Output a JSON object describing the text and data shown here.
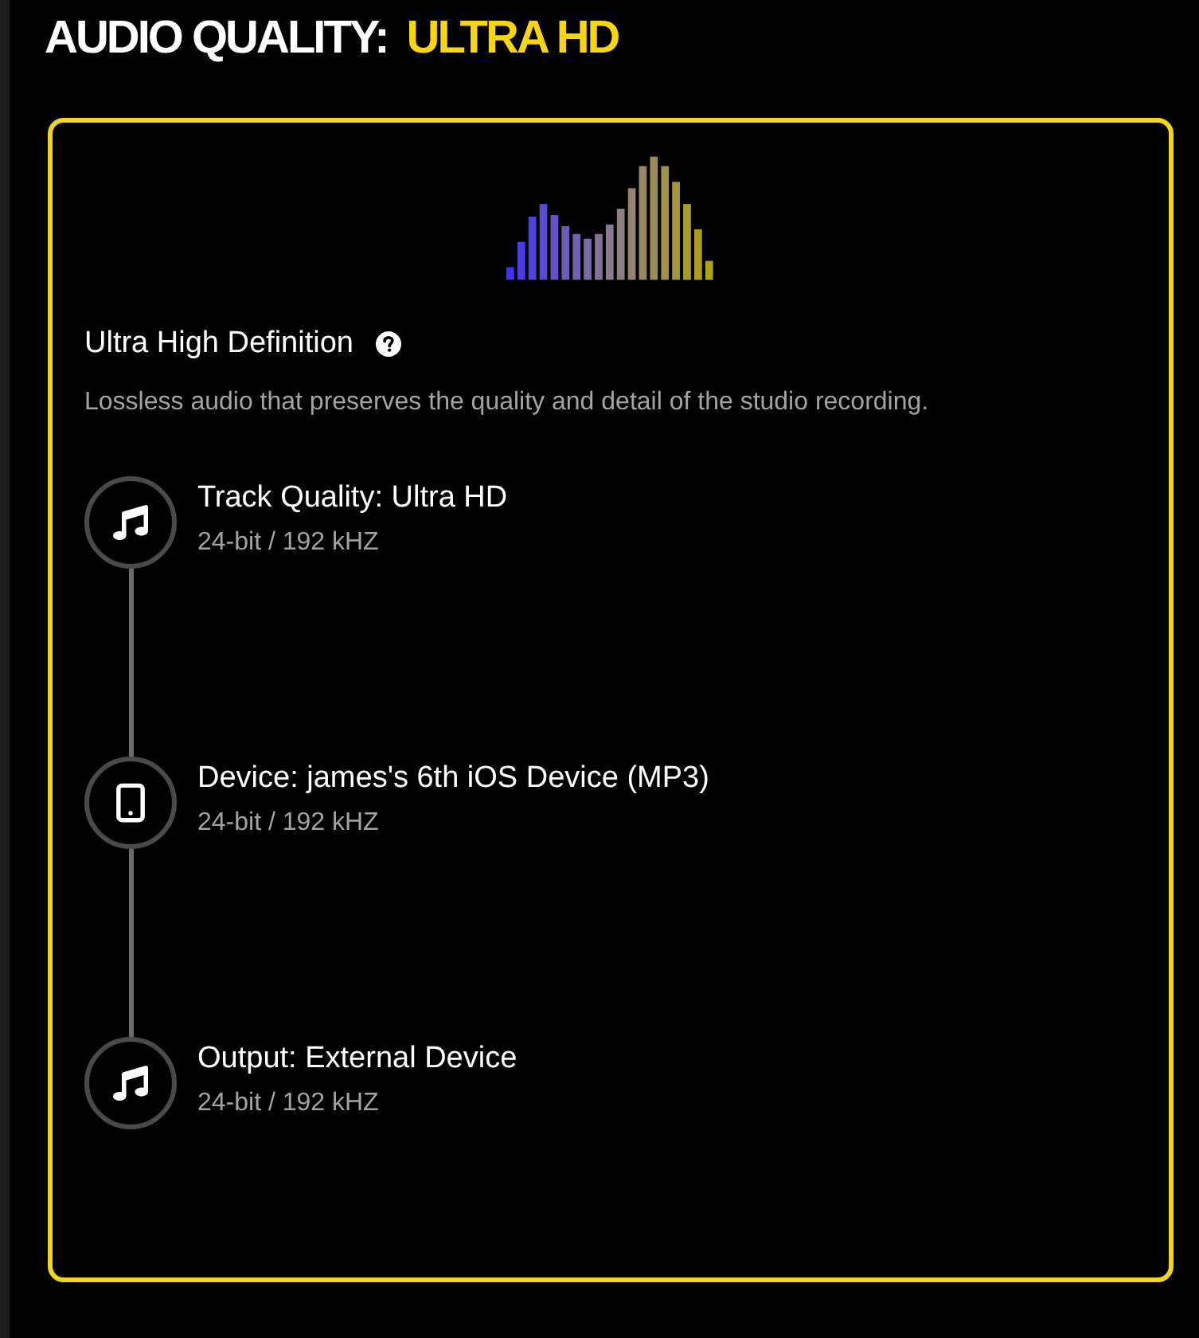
{
  "header": {
    "label": "AUDIO QUALITY:",
    "value": "ULTRA HD"
  },
  "quality_card": {
    "title": "Ultra High Definition",
    "description": "Lossless audio that preserves the quality and detail of the studio recording.",
    "steps": [
      {
        "kind": "track",
        "title": "Track Quality: Ultra HD",
        "detail": "24-bit / 192 kHZ"
      },
      {
        "kind": "device",
        "title": "Device: james's 6th iOS Device (MP3)",
        "detail": "24-bit / 192 kHZ"
      },
      {
        "kind": "output",
        "title": "Output: External Device",
        "detail": "24-bit / 192 kHZ"
      }
    ]
  }
}
